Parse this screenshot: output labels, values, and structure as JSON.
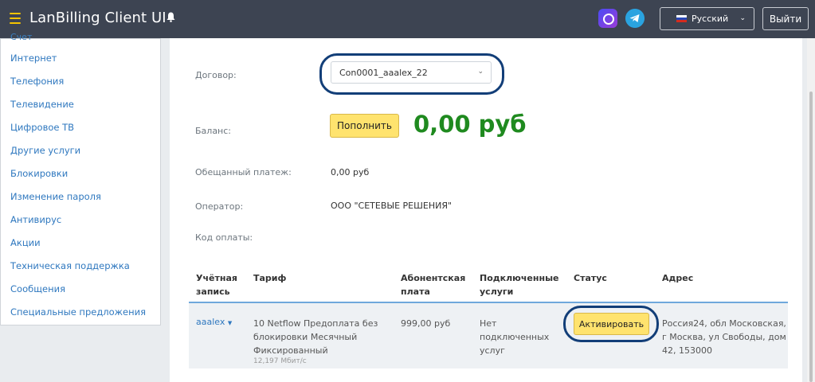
{
  "header": {
    "app_title": "LanBilling Client UI",
    "language": "Русский",
    "logout_label": "Выйти"
  },
  "sidebar": {
    "cut_item": "Счет",
    "items": [
      "Интернет",
      "Телефония",
      "Телевидение",
      "Цифровое ТВ",
      "Другие услуги",
      "Блокировки",
      "Изменение пароля",
      "Антивирус",
      "Акции",
      "Техническая поддержка",
      "Сообщения",
      "Специальные предложения"
    ]
  },
  "contract": {
    "label": "Договор:",
    "selected": "Con0001_aaalex_22"
  },
  "balance": {
    "label": "Баланс:",
    "topup_label": "Пополнить",
    "value": "0,00 руб"
  },
  "promised_payment": {
    "label": "Обещанный платеж:",
    "value": "0,00  руб"
  },
  "operator": {
    "label": "Оператор:",
    "value": "ООО \"СЕТЕВЫЕ РЕШЕНИЯ\""
  },
  "payment_code": {
    "label": "Код оплаты:"
  },
  "table": {
    "headers": {
      "account_1": "Учётная",
      "account_2": "запись",
      "tariff": "Тариф",
      "fee_1": "Абонентская",
      "fee_2": "плата",
      "services_1": "Подключенные",
      "services_2": "услуги",
      "status": "Статус",
      "address": "Адрес"
    },
    "row": {
      "account": "aaalex",
      "tariff_1": "10 Netflow Предоплата без",
      "tariff_2": "блокировки Месячный",
      "tariff_3": "Фиксированный",
      "speed": "12,197 Мбит/с",
      "fee": "999,00 руб",
      "services_1": "Нет",
      "services_2": "подключенных",
      "services_3": "услуг",
      "status_action": "Активировать",
      "address_1": "Россия24, обл Московская,",
      "address_2": "г Москва, ул Свободы, дом",
      "address_3": "42, 153000"
    }
  }
}
